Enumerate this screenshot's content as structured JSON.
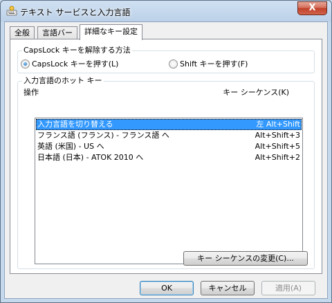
{
  "window": {
    "title": "テキスト サービスと入力言語",
    "close_label": "X"
  },
  "tabs": [
    {
      "label": "全般",
      "active": false
    },
    {
      "label": "言語バー",
      "active": false
    },
    {
      "label": "詳細なキー設定",
      "active": true
    }
  ],
  "capslock": {
    "group_label": "CapsLock キーを解除する方法",
    "options": [
      {
        "label": "CapsLock キーを押す(L)",
        "checked": true
      },
      {
        "label": "Shift キーを押す(F)",
        "checked": false
      }
    ]
  },
  "hotkeys": {
    "group_label": "入力言語のホット キー",
    "col_action": "操作",
    "col_sequence": "キー シーケンス(K)",
    "rows": [
      {
        "action": "入力言語を切り替える",
        "sequence": "左 Alt+Shift",
        "selected": true
      },
      {
        "action": "フランス語 (フランス) - フランス語 へ",
        "sequence": "Alt+Shift+3",
        "selected": false
      },
      {
        "action": "英語 (米国) - US へ",
        "sequence": "Alt+Shift+5",
        "selected": false
      },
      {
        "action": "日本語 (日本) - ATOK 2010 へ",
        "sequence": "Alt+Shift+2",
        "selected": false
      }
    ],
    "change_button": "キー シーケンスの変更(C)..."
  },
  "footer": {
    "ok": "OK",
    "cancel": "キャンセル",
    "apply": "適用(A)"
  }
}
